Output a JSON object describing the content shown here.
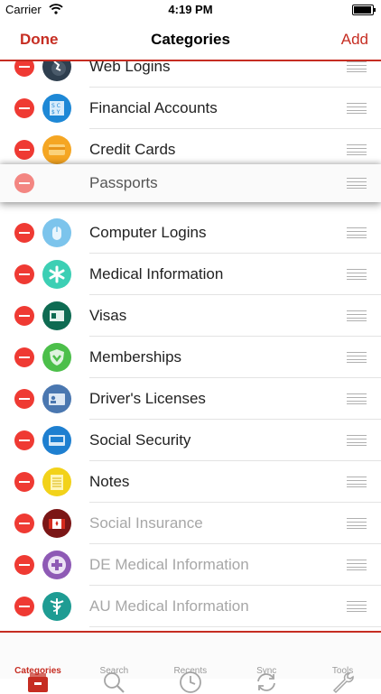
{
  "status": {
    "carrier": "Carrier",
    "time": "4:19 PM",
    "battery_level": 0.95
  },
  "nav": {
    "done": "Done",
    "title": "Categories",
    "add": "Add"
  },
  "categories": [
    {
      "label": "Web Logins",
      "icon": "globe-icon",
      "color": "#2f3f4f",
      "dimmed": false
    },
    {
      "label": "Financial Accounts",
      "icon": "bank-icon",
      "color": "#1e88d6",
      "dimmed": false
    },
    {
      "label": "Credit Cards",
      "icon": "credit-card-icon",
      "color": "#f5a623",
      "dimmed": false
    },
    {
      "label": "Passports",
      "icon": "passport-icon",
      "color": "#2f5b8c",
      "dimmed": false,
      "dragging": true
    },
    {
      "label": "Computer Logins",
      "icon": "mouse-icon",
      "color": "#7cc4ec",
      "dimmed": false
    },
    {
      "label": "Medical Information",
      "icon": "medical-icon",
      "color": "#3ccfb4",
      "dimmed": false
    },
    {
      "label": "Visas",
      "icon": "visa-icon",
      "color": "#0e6b52",
      "dimmed": false
    },
    {
      "label": "Memberships",
      "icon": "shield-icon",
      "color": "#4cbf4a",
      "dimmed": false
    },
    {
      "label": "Driver's Licenses",
      "icon": "id-card-icon",
      "color": "#4a77b0",
      "dimmed": false
    },
    {
      "label": "Social Security",
      "icon": "card-icon",
      "color": "#1e7fd0",
      "dimmed": false
    },
    {
      "label": "Notes",
      "icon": "notes-icon",
      "color": "#f2d21a",
      "dimmed": false
    },
    {
      "label": "Social Insurance",
      "icon": "canada-flag-icon",
      "color": "#7b1616",
      "dimmed": true
    },
    {
      "label": "DE Medical Information",
      "icon": "medical-cross-icon",
      "color": "#8e5ab5",
      "dimmed": true
    },
    {
      "label": "AU Medical Information",
      "icon": "caduceus-icon",
      "color": "#1e9c93",
      "dimmed": true
    }
  ],
  "tabs": [
    {
      "label": "Categories",
      "icon": "categories-icon",
      "active": true
    },
    {
      "label": "Search",
      "icon": "search-icon",
      "active": false
    },
    {
      "label": "Recents",
      "icon": "clock-icon",
      "active": false
    },
    {
      "label": "Sync",
      "icon": "sync-icon",
      "active": false
    },
    {
      "label": "Tools",
      "icon": "wrench-icon",
      "active": false
    }
  ],
  "colors": {
    "accent": "#c62d22",
    "delete": "#ef3a33"
  }
}
